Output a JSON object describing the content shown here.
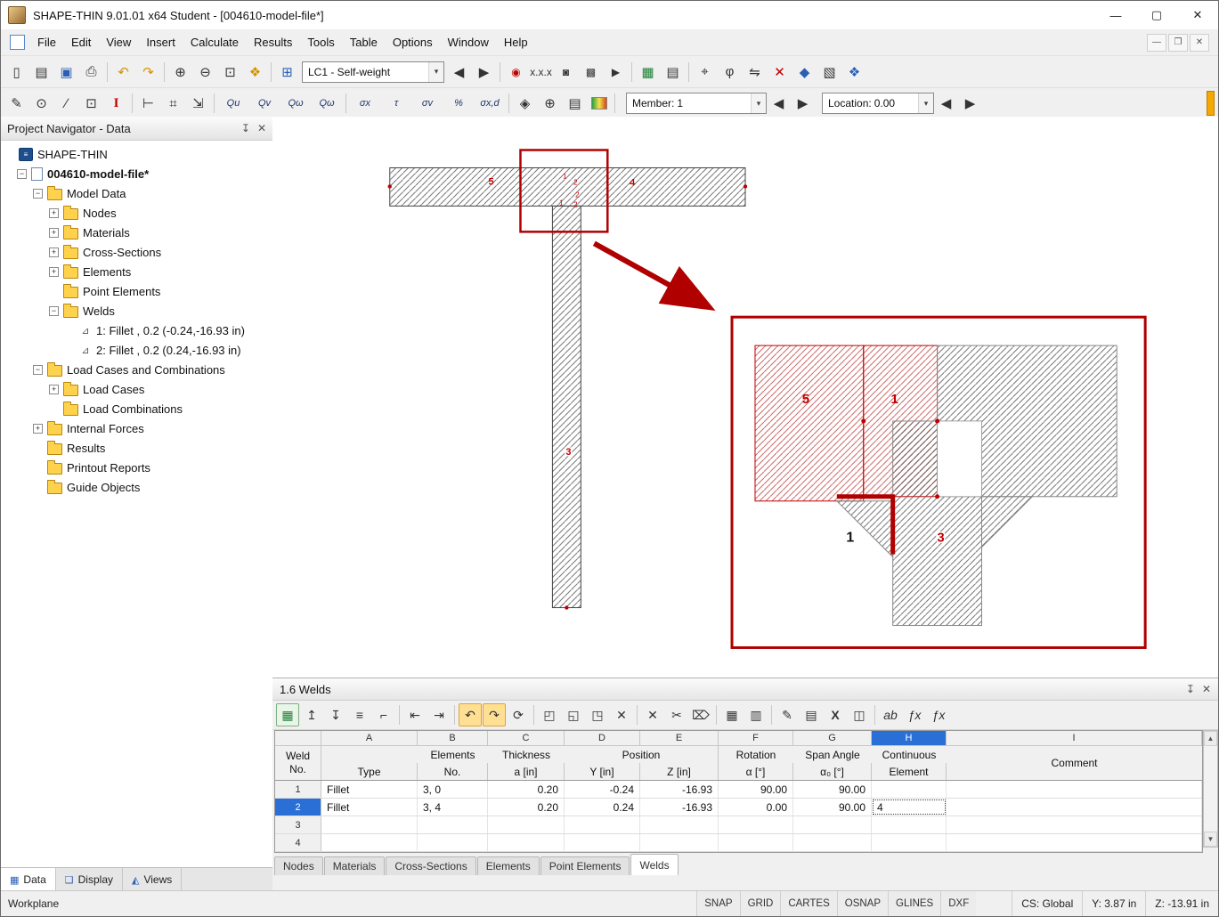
{
  "window": {
    "title": "SHAPE-THIN 9.01.01 x64 Student - [004610-model-file*]",
    "controls": {
      "minimize": "—",
      "maximize": "▢",
      "close": "✕"
    },
    "mdi": {
      "minimize": "—",
      "restore": "❐",
      "close": "✕"
    }
  },
  "menu": {
    "items": [
      {
        "id": "file",
        "label": "File"
      },
      {
        "id": "edit",
        "label": "Edit"
      },
      {
        "id": "view",
        "label": "View"
      },
      {
        "id": "insert",
        "label": "Insert"
      },
      {
        "id": "calculate",
        "label": "Calculate"
      },
      {
        "id": "results",
        "label": "Results"
      },
      {
        "id": "tools",
        "label": "Tools"
      },
      {
        "id": "table",
        "label": "Table"
      },
      {
        "id": "options",
        "label": "Options"
      },
      {
        "id": "window",
        "label": "Window"
      },
      {
        "id": "help",
        "label": "Help"
      }
    ]
  },
  "toolbar1": {
    "lc_value": "LC1 - Self-weight",
    "g1": [
      {
        "name": "new",
        "glyph": "▯"
      },
      {
        "name": "open",
        "glyph": "▤"
      },
      {
        "name": "save",
        "glyph": "▣"
      },
      {
        "name": "print",
        "glyph": "⎙"
      }
    ],
    "g2": [
      {
        "name": "undo",
        "glyph": "↶"
      },
      {
        "name": "redo",
        "glyph": "↷"
      }
    ],
    "g3": [
      {
        "name": "zoom-in",
        "glyph": "⊕"
      },
      {
        "name": "zoom-out",
        "glyph": "⊖"
      },
      {
        "name": "zoom-window",
        "glyph": "⊡"
      },
      {
        "name": "zoom-all",
        "glyph": "❖"
      }
    ],
    "g4": [
      {
        "name": "new-load-case",
        "glyph": "⊞"
      }
    ],
    "g5": [
      {
        "name": "previous-load-case",
        "glyph": "◀"
      },
      {
        "name": "next-load-case",
        "glyph": "▶"
      }
    ],
    "g6": [
      {
        "name": "show-results",
        "glyph": "◉"
      },
      {
        "name": "numbering",
        "glyph": "x.x.x"
      },
      {
        "name": "photo",
        "glyph": "◙"
      },
      {
        "name": "render",
        "glyph": "▩"
      },
      {
        "name": "animation",
        "glyph": "▶"
      }
    ],
    "g7": [
      {
        "name": "table-manager",
        "glyph": "▦"
      },
      {
        "name": "grid",
        "glyph": "▤"
      }
    ],
    "g8": [
      {
        "name": "snap",
        "glyph": "⌖"
      },
      {
        "name": "rotate",
        "glyph": "φ"
      },
      {
        "name": "mirror",
        "glyph": "⇋"
      },
      {
        "name": "delete",
        "glyph": "✕"
      },
      {
        "name": "solid-view",
        "glyph": "◆"
      },
      {
        "name": "image",
        "glyph": "▧"
      },
      {
        "name": "settings",
        "glyph": "❖"
      }
    ]
  },
  "toolbar2": {
    "member_label": "Member:",
    "member_value": "1",
    "location_label": "Location:",
    "location_value": "0.00",
    "g1": [
      {
        "name": "edit",
        "glyph": "✎"
      },
      {
        "name": "insert-node",
        "glyph": "⊙"
      },
      {
        "name": "insert-element",
        "glyph": "∕"
      },
      {
        "name": "insert-point",
        "glyph": "⊡"
      },
      {
        "name": "section-info",
        "glyph": "I"
      }
    ],
    "g2": [
      {
        "name": "align",
        "glyph": "⊢"
      },
      {
        "name": "measure",
        "glyph": "⌗"
      },
      {
        "name": "fit",
        "glyph": "⇲"
      }
    ],
    "g3": [
      {
        "name": "shear-qu",
        "glyph": "Qu"
      },
      {
        "name": "shear-qv",
        "glyph": "Qv"
      },
      {
        "name": "shear-qomega",
        "glyph": "Qω"
      },
      {
        "name": "shear-qomega2",
        "glyph": "Qω"
      }
    ],
    "g4": [
      {
        "name": "sigma-x",
        "glyph": "σx"
      },
      {
        "name": "tau",
        "glyph": "τ"
      },
      {
        "name": "sigma-v",
        "glyph": "σv"
      },
      {
        "name": "percent",
        "glyph": "%"
      },
      {
        "name": "sigma-xd",
        "glyph": "σx,d"
      }
    ],
    "g5": [
      {
        "name": "diaphragm",
        "glyph": "◈"
      },
      {
        "name": "center",
        "glyph": "⊕"
      },
      {
        "name": "report",
        "glyph": "▤"
      }
    ]
  },
  "navigator": {
    "title": "Project Navigator - Data",
    "tree": [
      {
        "id": "shape-thin",
        "indent": 4,
        "exp": "none",
        "eg": "",
        "icon": "app",
        "ig": "≡",
        "b": "",
        "label": "SHAPE-THIN"
      },
      {
        "id": "model-file",
        "indent": 18,
        "exp": "box",
        "eg": "−",
        "icon": "file",
        "ig": "",
        "b": "b",
        "label": "004610-model-file*"
      },
      {
        "id": "model-data",
        "indent": 36,
        "exp": "box",
        "eg": "−",
        "icon": "folder",
        "ig": "",
        "b": "",
        "label": "Model Data"
      },
      {
        "id": "nodes",
        "indent": 54,
        "exp": "box",
        "eg": "+",
        "icon": "folder",
        "ig": "",
        "b": "",
        "label": "Nodes"
      },
      {
        "id": "materials",
        "indent": 54,
        "exp": "box",
        "eg": "+",
        "icon": "folder",
        "ig": "",
        "b": "",
        "label": "Materials"
      },
      {
        "id": "cross-sections",
        "indent": 54,
        "exp": "box",
        "eg": "+",
        "icon": "folder",
        "ig": "",
        "b": "",
        "label": "Cross-Sections"
      },
      {
        "id": "elements",
        "indent": 54,
        "exp": "box",
        "eg": "+",
        "icon": "folder",
        "ig": "",
        "b": "",
        "label": "Elements"
      },
      {
        "id": "point-elements",
        "indent": 54,
        "exp": "none",
        "eg": "",
        "icon": "folder",
        "ig": "",
        "b": "",
        "label": "Point Elements"
      },
      {
        "id": "welds",
        "indent": 54,
        "exp": "box",
        "eg": "−",
        "icon": "folder",
        "ig": "",
        "b": "",
        "label": "Welds"
      },
      {
        "id": "weld-1",
        "indent": 72,
        "exp": "none",
        "eg": "",
        "icon": "weld",
        "ig": "⊿",
        "b": "",
        "label": "1: Fillet , 0.2 (-0.24,-16.93 in)"
      },
      {
        "id": "weld-2",
        "indent": 72,
        "exp": "none",
        "eg": "",
        "icon": "weld",
        "ig": "⊿",
        "b": "",
        "label": "2: Fillet , 0.2 (0.24,-16.93 in)"
      },
      {
        "id": "load-cases-and-combinations",
        "indent": 36,
        "exp": "box",
        "eg": "−",
        "icon": "folder",
        "ig": "",
        "b": "",
        "label": "Load Cases and Combinations"
      },
      {
        "id": "load-cases",
        "indent": 54,
        "exp": "box",
        "eg": "+",
        "icon": "folder",
        "ig": "",
        "b": "",
        "label": "Load Cases"
      },
      {
        "id": "load-combinations",
        "indent": 54,
        "exp": "none",
        "eg": "",
        "icon": "folder",
        "ig": "",
        "b": "",
        "label": "Load Combinations"
      },
      {
        "id": "internal-forces",
        "indent": 36,
        "exp": "box",
        "eg": "+",
        "icon": "folder",
        "ig": "",
        "b": "",
        "label": "Internal Forces"
      },
      {
        "id": "results",
        "indent": 36,
        "exp": "none",
        "eg": "",
        "icon": "folder",
        "ig": "",
        "b": "",
        "label": "Results"
      },
      {
        "id": "printout-reports",
        "indent": 36,
        "exp": "none",
        "eg": "",
        "icon": "folder",
        "ig": "",
        "b": "",
        "label": "Printout Reports"
      },
      {
        "id": "guide-objects",
        "indent": 36,
        "exp": "none",
        "eg": "",
        "icon": "folder",
        "ig": "",
        "b": "",
        "label": "Guide Objects"
      }
    ],
    "tabs": [
      {
        "id": "data",
        "label": "Data",
        "ig": "▦",
        "cls": "active"
      },
      {
        "id": "display",
        "label": "Display",
        "ig": "❑",
        "cls": ""
      },
      {
        "id": "views",
        "label": "Views",
        "ig": "◭",
        "cls": ""
      }
    ]
  },
  "graphics": {
    "flange_left": "5",
    "flange_right": "4",
    "web": "3",
    "cluster": [
      "1",
      "2",
      "2",
      "1",
      "2"
    ],
    "detail": {
      "left": "5",
      "top": "1",
      "web": "3",
      "weld": "1"
    }
  },
  "welds_panel": {
    "title": "1.6 Welds",
    "toolbar": {
      "g1": [
        {
          "name": "table-settings",
          "glyph": "▦"
        },
        {
          "name": "row-up",
          "glyph": "↥"
        },
        {
          "name": "row-down",
          "glyph": "↧"
        },
        {
          "name": "clear-rows",
          "glyph": "≡"
        },
        {
          "name": "corner",
          "glyph": "⌐"
        }
      ],
      "g2": [
        {
          "name": "move-first",
          "glyph": "⇤"
        },
        {
          "name": "move-last",
          "glyph": "⇥"
        }
      ],
      "g3": [
        {
          "name": "undo",
          "glyph": "↶"
        },
        {
          "name": "redo",
          "glyph": "↷"
        },
        {
          "name": "refresh",
          "glyph": "⟳"
        }
      ],
      "g4": [
        {
          "name": "select-corner",
          "glyph": "◰"
        },
        {
          "name": "select-row",
          "glyph": "◱"
        },
        {
          "name": "select-region",
          "glyph": "◳"
        },
        {
          "name": "cancel",
          "glyph": "✕"
        }
      ],
      "g5": [
        {
          "name": "delete-row",
          "glyph": "✕"
        },
        {
          "name": "delete-rows",
          "glyph": "✂"
        },
        {
          "name": "delete-all",
          "glyph": "⌦"
        }
      ],
      "g6": [
        {
          "name": "table-fill",
          "glyph": "▦"
        },
        {
          "name": "table-borders",
          "glyph": "▥"
        }
      ],
      "g7": [
        {
          "name": "edit-cell",
          "glyph": "✎"
        },
        {
          "name": "notes",
          "glyph": "▤"
        },
        {
          "name": "export-excel",
          "glyph": "X"
        },
        {
          "name": "calculator",
          "glyph": "◫"
        }
      ],
      "g8": [
        {
          "name": "rename",
          "glyph": "ab"
        },
        {
          "name": "formula",
          "glyph": "ƒx"
        },
        {
          "name": "formula-clear",
          "glyph": "ƒx"
        }
      ]
    },
    "table": {
      "corner1": "Weld",
      "corner2": "No.",
      "letters": [
        {
          "l": "A",
          "cls": ""
        },
        {
          "l": "B",
          "cls": ""
        },
        {
          "l": "C",
          "cls": ""
        },
        {
          "l": "D",
          "cls": ""
        },
        {
          "l": "E",
          "cls": ""
        },
        {
          "l": "F",
          "cls": ""
        },
        {
          "l": "G",
          "cls": ""
        },
        {
          "l": "H",
          "cls": "hsel"
        },
        {
          "l": "I",
          "cls": ""
        }
      ],
      "labels": {
        "type": "Type",
        "elements": "Elements",
        "no": "No.",
        "thickness": "Thickness",
        "a": "a [in]",
        "position": "Position",
        "y": "Y [in]",
        "z": "Z [in]",
        "rotation": "Rotation",
        "alpha": "α [°]",
        "span": "Span Angle",
        "alpha0": "α₀ [°]",
        "continuous": "Continuous",
        "element": "Element",
        "comment": "Comment"
      },
      "rows": [
        {
          "no": "1",
          "sel": "",
          "type": "Fillet",
          "el": "3, 0",
          "a": "0.20",
          "y": "-0.24",
          "z": "-16.93",
          "rot": "90.00",
          "span": "90.00",
          "cont": "",
          "com": "",
          "hfoc": ""
        },
        {
          "no": "2",
          "sel": "sel",
          "type": "Fillet",
          "el": "3, 4",
          "a": "0.20",
          "y": "0.24",
          "z": "-16.93",
          "rot": "0.00",
          "span": "90.00",
          "cont": "4",
          "com": "",
          "hfoc": "hfoc"
        },
        {
          "no": "3",
          "sel": "",
          "type": "",
          "el": "",
          "a": "",
          "y": "",
          "z": "",
          "rot": "",
          "span": "",
          "cont": "",
          "com": "",
          "hfoc": ""
        },
        {
          "no": "4",
          "sel": "",
          "type": "",
          "el": "",
          "a": "",
          "y": "",
          "z": "",
          "rot": "",
          "span": "",
          "cont": "",
          "com": "",
          "hfoc": ""
        }
      ]
    },
    "tabs": [
      {
        "id": "nodes",
        "label": "Nodes",
        "cls": ""
      },
      {
        "id": "materials",
        "label": "Materials",
        "cls": ""
      },
      {
        "id": "cross-sections",
        "label": "Cross-Sections",
        "cls": ""
      },
      {
        "id": "elements",
        "label": "Elements",
        "cls": ""
      },
      {
        "id": "point-elements",
        "label": "Point Elements",
        "cls": ""
      },
      {
        "id": "welds",
        "label": "Welds",
        "cls": "active"
      }
    ]
  },
  "statusbar": {
    "left": "Workplane",
    "toggles": [
      {
        "id": "snap",
        "label": "SNAP"
      },
      {
        "id": "grid",
        "label": "GRID"
      },
      {
        "id": "cartes",
        "label": "CARTES"
      },
      {
        "id": "osnap",
        "label": "OSNAP"
      },
      {
        "id": "glines",
        "label": "GLINES"
      },
      {
        "id": "dxf",
        "label": "DXF"
      }
    ],
    "cs": "CS: Global",
    "y": "Y:  3.87 in",
    "z": "Z:  -13.91 in"
  }
}
